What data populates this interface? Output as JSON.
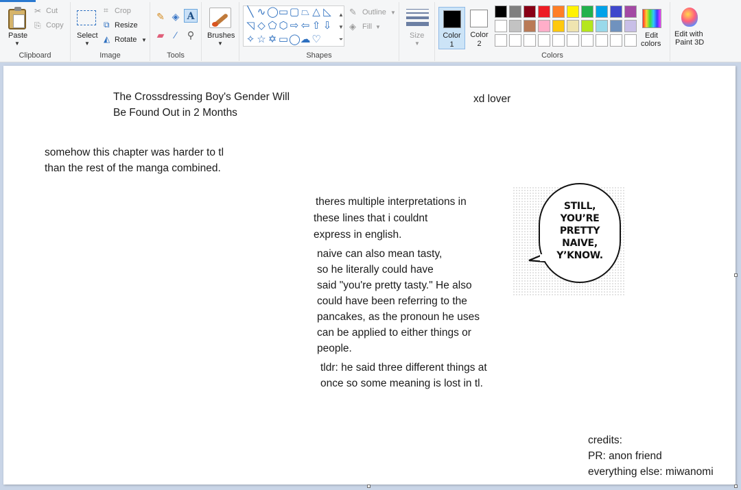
{
  "ribbon": {
    "clipboard": {
      "paste": "Paste",
      "cut": "Cut",
      "copy": "Copy",
      "group": "Clipboard"
    },
    "image": {
      "select": "Select",
      "crop": "Crop",
      "resize": "Resize",
      "rotate": "Rotate",
      "group": "Image"
    },
    "tools": {
      "group": "Tools"
    },
    "brushes": {
      "label": "Brushes"
    },
    "shapes": {
      "outline": "Outline",
      "fill": "Fill",
      "group": "Shapes"
    },
    "size": {
      "label": "Size"
    },
    "colors": {
      "color1_line1": "Color",
      "color1_line2": "1",
      "color2_line1": "Color",
      "color2_line2": "2",
      "edit_line1": "Edit",
      "edit_line2": "colors",
      "group": "Colors",
      "color1_value": "#000000",
      "color2_value": "#ffffff",
      "palette_row1": [
        "#000000",
        "#7f7f7f",
        "#880015",
        "#ed1c24",
        "#ff7f27",
        "#fff200",
        "#22b14c",
        "#00a2e8",
        "#3f48cc",
        "#a349a4"
      ],
      "palette_row2": [
        "#ffffff",
        "#c3c3c3",
        "#b97a57",
        "#ffaec9",
        "#ffc90e",
        "#efe4b0",
        "#b5e61d",
        "#99d9ea",
        "#7092be",
        "#c8bfe7"
      ],
      "palette_row3": [
        "#ffffff",
        "#ffffff",
        "#ffffff",
        "#ffffff",
        "#ffffff",
        "#ffffff",
        "#ffffff",
        "#ffffff",
        "#ffffff",
        "#ffffff"
      ]
    },
    "paint3d": {
      "line1": "Edit with",
      "line2": "Paint 3D"
    }
  },
  "canvas": {
    "title_line1": "The Crossdressing Boy's Gender Will",
    "title_line2": "Be Found Out in 2 Months",
    "xd": "xd lover",
    "note1_line1": "somehow this chapter was harder to tl",
    "note1_line2": "than the rest of the manga combined.",
    "interp_line1": "theres multiple interpretations in",
    "interp_line2": "these lines that i couldnt",
    "interp_line3": "express in english.",
    "naive_line1": "naive can also mean tasty,",
    "naive_line2": "so he literally could have",
    "naive_line3": "said \"you're pretty tasty.\" He also",
    "naive_line4": "could have been referring to the",
    "naive_line5": "pancakes, as the pronoun he uses",
    "naive_line6": "can be applied to either things or",
    "naive_line7": "people.",
    "tldr_line1": "tldr: he said three different things at",
    "tldr_line2": "once so some meaning is lost in tl.",
    "credits_line1": "credits:",
    "credits_line2": "PR: anon friend",
    "credits_line3": "everything else: miwanomi"
  }
}
